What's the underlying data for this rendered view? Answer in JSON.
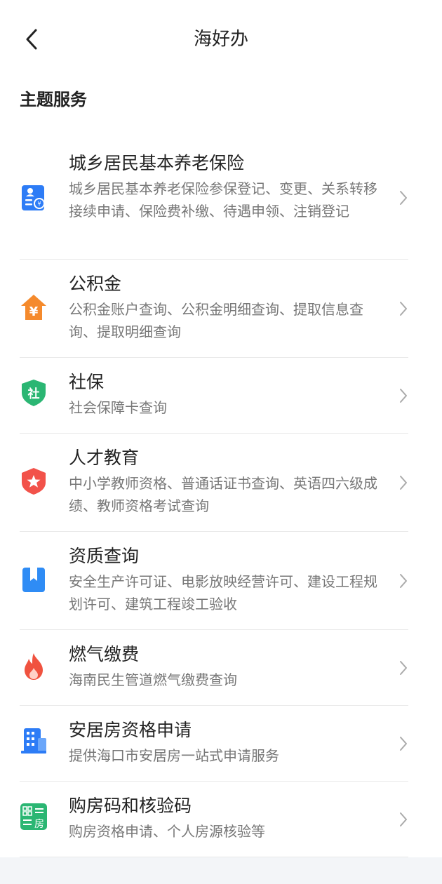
{
  "nav": {
    "title": "海好办",
    "back_icon": "chevron-left-icon"
  },
  "section": {
    "title": "主题服务"
  },
  "items": [
    {
      "title": "城乡居民基本养老保险",
      "desc": "城乡居民基本养老保险参保登记、变更、关系转移接续申请、保险费补缴、待遇申领、注销登记",
      "icon": "pension-card-icon",
      "color": "#2d7cf6"
    },
    {
      "title": "公积金",
      "desc": "公积金账户查询、公积金明细查询、提取信息查询、提取明细查询",
      "icon": "house-yuan-icon",
      "color": "#f58a2c"
    },
    {
      "title": "社保",
      "desc": "社会保障卡查询",
      "icon": "shield-she-icon",
      "color": "#2bb673"
    },
    {
      "title": "人才教育",
      "desc": "中小学教师资格、普通话证书查询、英语四六级成绩、教师资格考试查询",
      "icon": "shield-star-icon",
      "color": "#f2524a"
    },
    {
      "title": "资质查询",
      "desc": "安全生产许可证、电影放映经营许可、建设工程规划许可、建筑工程竣工验收",
      "icon": "bookmark-icon",
      "color": "#2f8cf5"
    },
    {
      "title": "燃气缴费",
      "desc": "海南民生管道燃气缴费查询",
      "icon": "flame-icon",
      "color": "#f0523f"
    },
    {
      "title": "安居房资格申请",
      "desc": "提供海口市安居房一站式申请服务",
      "icon": "building-icon",
      "color": "#2d7cf6"
    },
    {
      "title": "购房码和核验码",
      "desc": "购房资格申请、个人房源核验等",
      "icon": "qrcode-house-icon",
      "color": "#2bb673"
    }
  ]
}
